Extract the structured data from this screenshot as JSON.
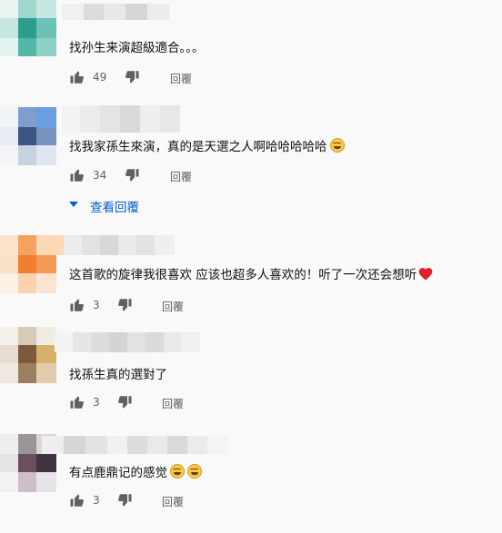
{
  "comments": [
    {
      "text": "找孙生来演超級適合。。。",
      "emoji_count": 0,
      "heart": false,
      "likes": "49",
      "reply_label": "回覆",
      "avatar_colors": [
        "#bfe3dc",
        "#3aa99a",
        "#67c1b3",
        "#d8efeb",
        "#2f9b8c",
        "#8dd0c4"
      ]
    },
    {
      "text": "找我家孫生來演，真的是天選之人啊哈哈哈哈哈",
      "emoji_count": 1,
      "heart": false,
      "likes": "34",
      "reply_label": "回覆",
      "view_replies": "查看回覆",
      "avatar_colors": [
        "#e2e7f0",
        "#6e8fbd",
        "#7ba6e0",
        "#eef1f6",
        "#3d5583",
        "#a9bfdc"
      ]
    },
    {
      "text": "这首歌的旋律我很喜欢 应该也超多人喜欢的！听了一次还会想听",
      "emoji_count": 0,
      "heart": true,
      "likes": "3",
      "reply_label": "回覆",
      "avatar_colors": [
        "#f7c9a1",
        "#f07f31",
        "#f6a864",
        "#fbe0c8",
        "#ef8a3e",
        "#f9c59a"
      ]
    },
    {
      "text": "找孫生真的選對了",
      "emoji_count": 0,
      "heart": false,
      "likes": "3",
      "reply_label": "回覆",
      "avatar_colors": [
        "#e8dfd2",
        "#8b6a45",
        "#d9b98c",
        "#efe6d9",
        "#a88a66",
        "#e3ccac"
      ]
    },
    {
      "text": "有点鹿鼎记的感觉",
      "emoji_count": 2,
      "heart": false,
      "likes": "3",
      "reply_label": "回覆",
      "avatar_colors": [
        "#d9d6d9",
        "#6b4f60",
        "#b8aab5",
        "#ecebec",
        "#4e3f4a",
        "#cfc6cd"
      ]
    }
  ]
}
